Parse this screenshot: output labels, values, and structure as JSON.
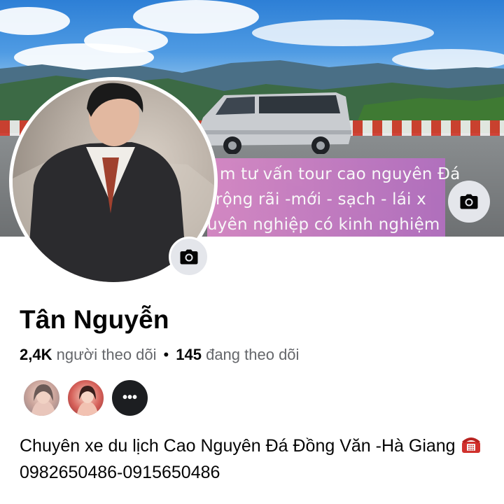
{
  "cover": {
    "banner_lines": [
      "m tư vấn tour cao nguyên Đá",
      "rộng rãi -mới - sạch -  lái x",
      "uyên nghiệp có kinh nghiệm"
    ]
  },
  "profile": {
    "name": "Tân Nguyễn",
    "followers_count": "2,4K",
    "followers_label": "người theo dõi",
    "separator": "•",
    "following_count": "145",
    "following_label": "đang theo dõi",
    "friends_more": "•••",
    "bio_text": "Chuyên xe du lịch Cao Nguyên Đá Đồng Văn -Hà Giang ",
    "bio_phone": "0982650486-0915650486"
  },
  "icons": {
    "cover_camera": "camera-icon",
    "avatar_camera": "camera-icon",
    "phone": "telephone-icon"
  },
  "colors": {
    "secondary_text": "#65676b",
    "button_bg": "#e4e6eb",
    "banner_pink": "#d889c6"
  }
}
